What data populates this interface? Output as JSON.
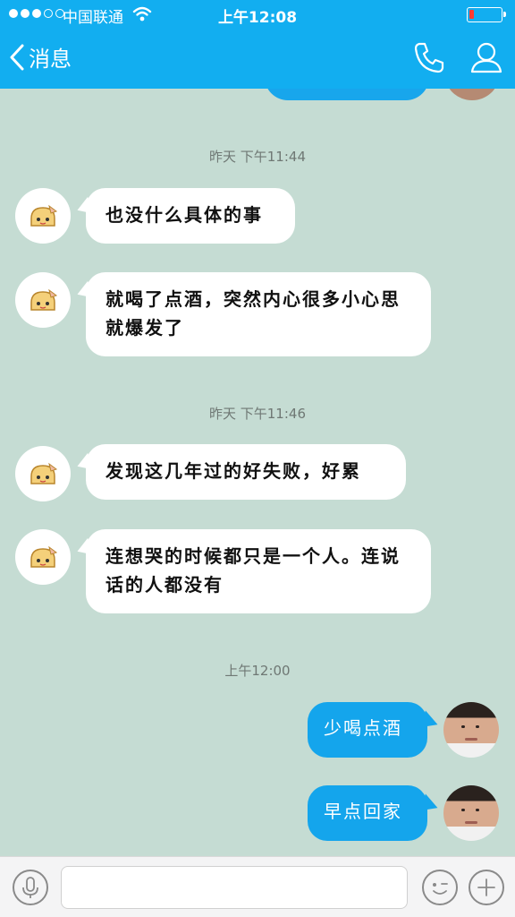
{
  "status_bar": {
    "carrier": "中国联通",
    "time": "上午12:08"
  },
  "header": {
    "back_label": "消息"
  },
  "messages": [
    {
      "timestamp": "昨天 下午11:44"
    },
    {
      "text": "也没什么具体的事"
    },
    {
      "text": "就喝了点酒，突然内心很多小心思就爆发了"
    },
    {
      "timestamp": "昨天 下午11:46"
    },
    {
      "text": "发现这几年过的好失败，好累"
    },
    {
      "text": "连想哭的时候都只是一个人。连说话的人都没有"
    },
    {
      "timestamp": "上午12:00"
    },
    {
      "text": "少喝点酒"
    },
    {
      "text": "早点回家"
    }
  ],
  "input": {
    "value": ""
  },
  "colors": {
    "header": "#12aef0",
    "chat_bg": "#c5dcd3",
    "outgoing_bubble": "#14a5ec",
    "incoming_bubble": "#ffffff"
  },
  "icons": [
    "signal-dots",
    "wifi-icon",
    "battery-icon",
    "back-chevron-icon",
    "phone-icon",
    "contact-icon",
    "voice-icon",
    "emoji-icon",
    "plus-icon"
  ]
}
